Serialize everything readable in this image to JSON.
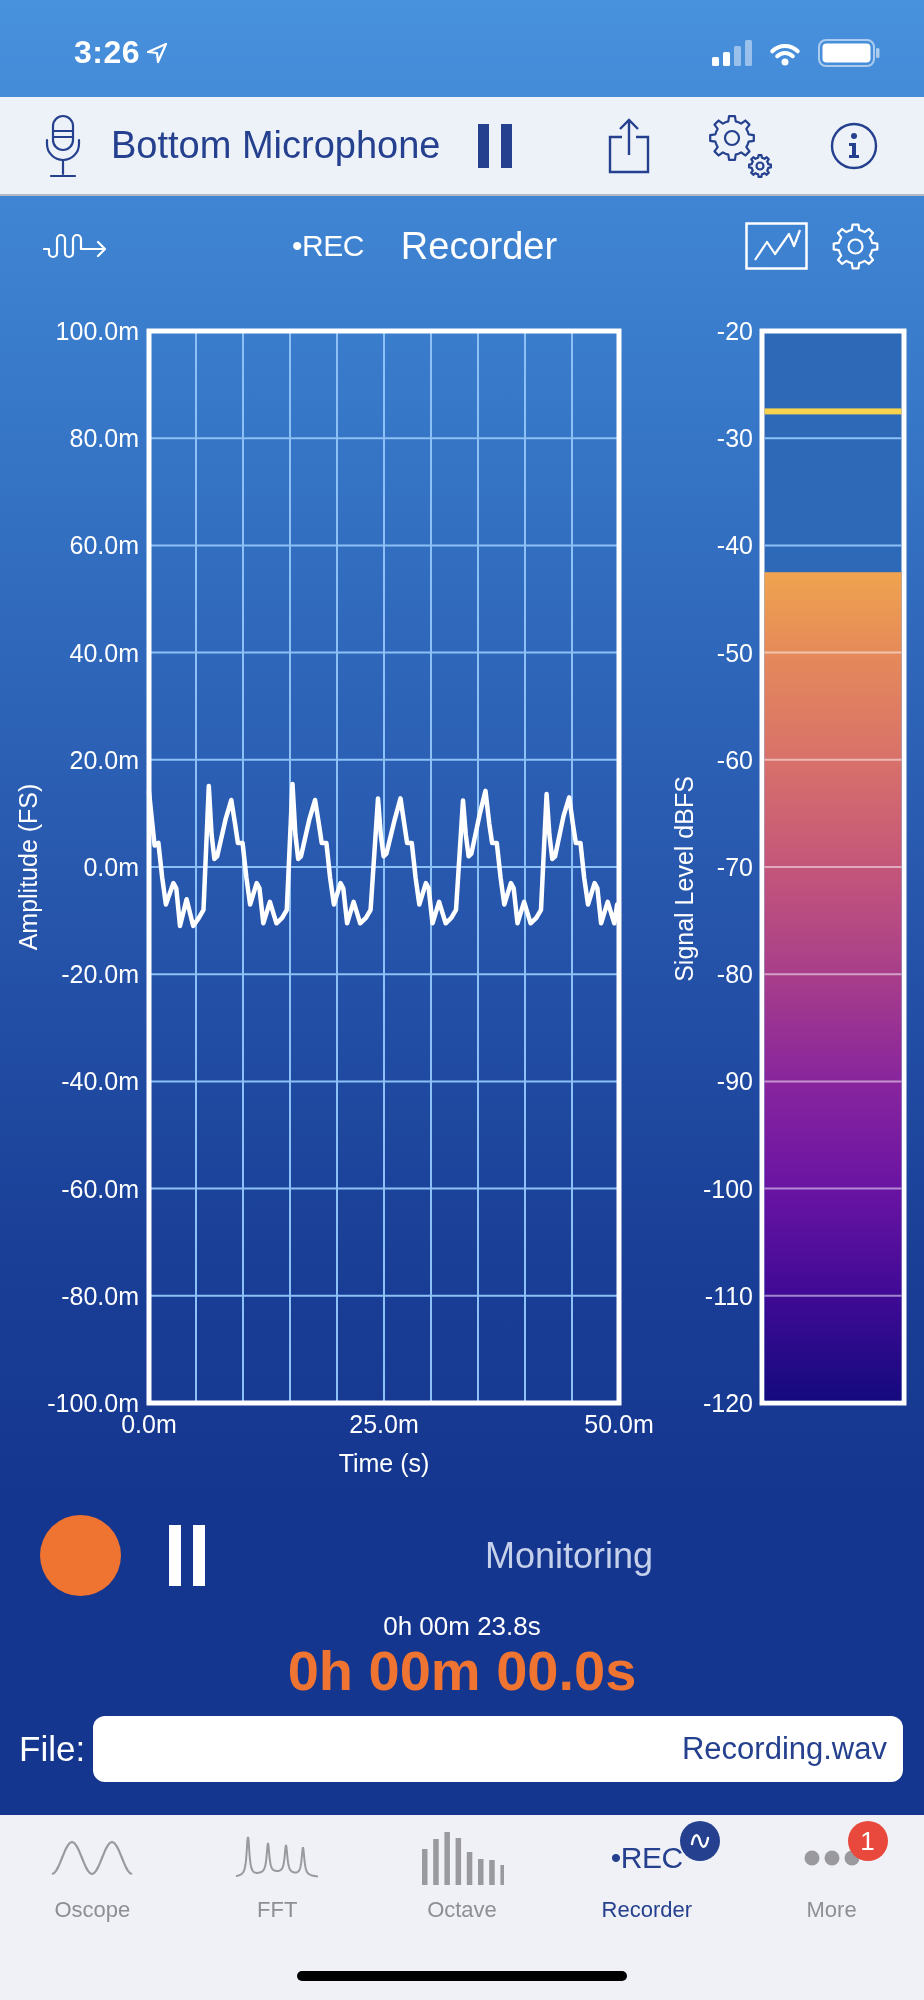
{
  "status_bar": {
    "time": "3:26"
  },
  "toolbar": {
    "input_device": "Bottom Microphone"
  },
  "header": {
    "logo": "•REC",
    "title": "Recorder"
  },
  "scope": {
    "chart_data": {
      "type": "line",
      "xlabel": "Time (s)",
      "ylabel": "Amplitude (FS)",
      "grid": true,
      "xlim": [
        0,
        50
      ],
      "ylim": [
        -100,
        100
      ],
      "xticks": [
        {
          "value": 0,
          "label": "0.0m"
        },
        {
          "value": 25,
          "label": "25.0m"
        },
        {
          "value": 50,
          "label": "50.0m"
        }
      ],
      "yticks": [
        {
          "value": 100,
          "label": "100.0m"
        },
        {
          "value": 80,
          "label": "80.0m"
        },
        {
          "value": 60,
          "label": "60.0m"
        },
        {
          "value": 40,
          "label": "40.0m"
        },
        {
          "value": 20,
          "label": "20.0m"
        },
        {
          "value": 0,
          "label": "0.0m"
        },
        {
          "value": -20,
          "label": "-20.0m"
        },
        {
          "value": -40,
          "label": "-40.0m"
        },
        {
          "value": -60,
          "label": "-60.0m"
        },
        {
          "value": -80,
          "label": "-80.0m"
        },
        {
          "value": -100,
          "label": "-100.0m"
        }
      ],
      "x": [
        0,
        0.3,
        0.6,
        1.0,
        1.4,
        1.8,
        2.6,
        2.9,
        3.3,
        4.0,
        4.7,
        5.3,
        5.8,
        6.36,
        6.66,
        6.96,
        7.26,
        8.16,
        8.76,
        9.16,
        9.46,
        9.96,
        10.36,
        10.76,
        11.46,
        11.76,
        12.16,
        12.86,
        13.56,
        14.16,
        14.66,
        15.27,
        15.57,
        15.87,
        16.17,
        17.07,
        17.67,
        18.07,
        18.37,
        18.87,
        19.27,
        19.67,
        20.37,
        20.67,
        21.07,
        21.77,
        22.47,
        23.07,
        23.57,
        24.36,
        24.66,
        24.96,
        25.26,
        26.16,
        26.76,
        27.16,
        27.46,
        27.96,
        28.36,
        28.76,
        29.46,
        29.76,
        30.16,
        30.86,
        31.56,
        32.16,
        32.66,
        33.4,
        33.7,
        34.0,
        34.3,
        35.2,
        35.8,
        36.2,
        36.5,
        37.0,
        37.4,
        37.8,
        38.5,
        38.8,
        39.2,
        39.9,
        40.6,
        41.2,
        41.7,
        42.3,
        42.6,
        42.9,
        43.2,
        44.1,
        44.7,
        45.1,
        45.4,
        45.9,
        46.3,
        46.7,
        47.4,
        47.7,
        48.1,
        48.8,
        49.5,
        49.8,
        50.0
      ],
      "series": [
        {
          "color": "#ffffff",
          "values": [
            14,
            9,
            4,
            4.5,
            -2,
            -7,
            -3,
            -4,
            -11,
            -6,
            -11,
            -9.5,
            -8,
            15.1,
            6,
            1.5,
            2,
            9,
            12.5,
            8,
            4.5,
            4.5,
            -2,
            -7,
            -3,
            -4,
            -10.5,
            -6.5,
            -10.5,
            -9.5,
            -8,
            15.5,
            6,
            1.5,
            2,
            9,
            12.5,
            8,
            4.5,
            4.5,
            -2,
            -7,
            -3,
            -4,
            -10.5,
            -6.5,
            -10.5,
            -9.5,
            -8,
            12.8,
            6,
            2,
            2.5,
            9,
            12.8,
            8,
            4.5,
            4.5,
            -2,
            -7,
            -3,
            -4,
            -10.5,
            -6.5,
            -10.5,
            -9.5,
            -8,
            12.4,
            6,
            2,
            2.5,
            10,
            14.2,
            8,
            4.5,
            4.5,
            -2,
            -7,
            -3,
            -4,
            -10.5,
            -6.5,
            -10.5,
            -9.5,
            -8,
            13.6,
            6,
            1.5,
            2,
            9.5,
            13,
            8,
            4.5,
            4.5,
            -2,
            -7,
            -3,
            -4,
            -10.5,
            -6.5,
            -10.5,
            -7,
            -9
          ]
        }
      ]
    }
  },
  "meter": {
    "axis_label": "Signal Level dBFS",
    "ticks": [
      "-20",
      "-30",
      "-40",
      "-50",
      "-60",
      "-70",
      "-80",
      "-90",
      "-100",
      "-110",
      "-120"
    ],
    "level": 0.775,
    "peak": {
      "level": 0.925
    }
  },
  "transport": {
    "status": "Monitoring",
    "elapsed": "0h 00m 23.8s",
    "record_time": "0h 00m 00.0s"
  },
  "file": {
    "label": "File:",
    "value": "Recording.wav"
  },
  "tabs": [
    {
      "label": "Oscope",
      "kind": "sine",
      "selected": false
    },
    {
      "label": "FFT",
      "kind": "peaks",
      "selected": false
    },
    {
      "label": "Octave",
      "kind": "bars",
      "selected": false
    },
    {
      "label": "Recorder",
      "kind": "text",
      "icon_text": "•REC",
      "selected": true
    },
    {
      "label": "More",
      "kind": "dots",
      "badge": "1",
      "selected": false
    }
  ]
}
